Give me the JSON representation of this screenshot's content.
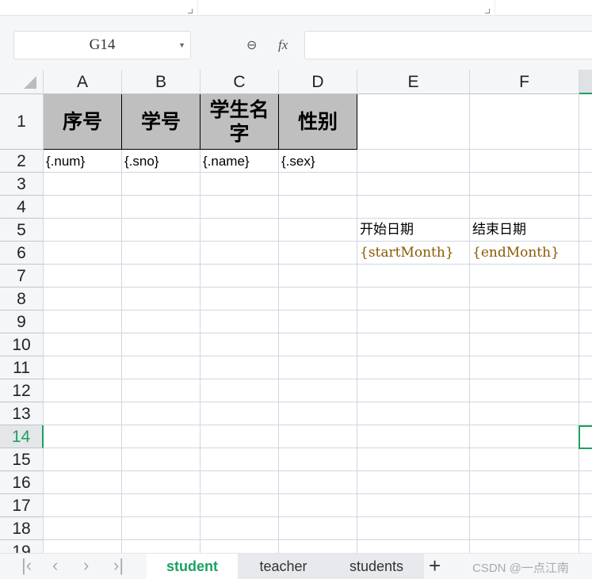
{
  "formula_bar": {
    "name_box": "G14",
    "formula": ""
  },
  "columns": [
    "A",
    "B",
    "C",
    "D",
    "E",
    "F"
  ],
  "rows": [
    "1",
    "2",
    "3",
    "4",
    "5",
    "6",
    "7",
    "8",
    "9",
    "10",
    "11",
    "12",
    "13",
    "14",
    "15",
    "16",
    "17",
    "18",
    "19"
  ],
  "cells": {
    "A1": "序号",
    "B1": "学号",
    "C1": "学生名字",
    "D1": "性别",
    "A2": "{.num}",
    "B2": "{.sno}",
    "C2": "{.name}",
    "D2": "{.sex}",
    "E5": "开始日期",
    "F5": "结束日期",
    "E6": "{startMonth}",
    "F6": "{endMonth}"
  },
  "sheet_tabs": [
    {
      "label": "student",
      "active": true
    },
    {
      "label": "teacher",
      "active": false
    },
    {
      "label": "students",
      "active": false
    }
  ],
  "watermark": "CSDN @一点江南",
  "colors": {
    "accent": "#1aa260",
    "header_fill": "#bfbfbf"
  }
}
